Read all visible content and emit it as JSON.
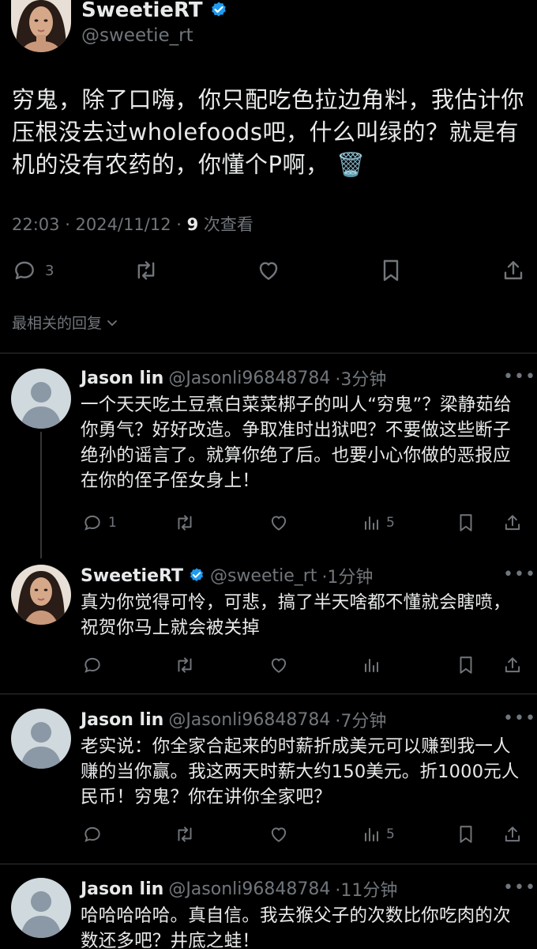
{
  "post": {
    "author_name": "SweetieRT",
    "author_handle": "@sweetie_rt",
    "text": "穷鬼，除了口嗨，你只配吃色拉边角料，我估计你压根没去过wholefoods吧，什么叫绿的？就是有机的没有农药的，你懂个P啊，",
    "emoji": "🗑️",
    "time": "22:03 · 2024/11/12 · ",
    "views_count": "9",
    "views_label": " 次查看",
    "reply_count": "3"
  },
  "sort_label": "最相关的回复",
  "replies": [
    {
      "name": "Jason lin",
      "handle": "@Jasonli96848784",
      "time": "·3分钟",
      "text": "一个天天吃土豆煮白菜菜梆子的叫人“穷鬼”？梁静茹给你勇气？好好改造。争取准时出狱吧？不要做这些断子绝孙的谣言了。就算你绝了后。也要小心你做的恶报应在你的侄子侄女身上！",
      "replies": "1",
      "views": "5"
    },
    {
      "name": "SweetieRT",
      "handle": "@sweetie_rt",
      "time": "·1分钟",
      "text": "真为你觉得可怜，可悲，搞了半天啥都不懂就会瞎喷，祝贺你马上就会被关掉",
      "replies": "",
      "views": ""
    },
    {
      "name": "Jason lin",
      "handle": "@Jasonli96848784",
      "time": "·7分钟",
      "text": "老实说：你全家合起来的时薪折成美元可以赚到我一人赚的当你赢。我这两天时薪大约150美元。折1000元人民币！穷鬼？你在讲你全家吧？",
      "replies": "",
      "views": "5"
    },
    {
      "name": "Jason lin",
      "handle": "@Jasonli96848784",
      "time": "·11分钟",
      "text": "哈哈哈哈哈。真自信。我去猴父子的次数比你吃肉的次数还多吧？井底之蛙！",
      "replies": "",
      "views": ""
    }
  ],
  "colors": {
    "verified": "#1d9bf0",
    "muted": "#71767b",
    "text": "#e7e9ea",
    "divider": "#2f3336"
  },
  "icons": [
    "verified-badge-icon",
    "reply-icon",
    "repost-icon",
    "like-icon",
    "bookmark-icon",
    "share-icon",
    "views-icon",
    "chevron-down-icon",
    "more-icon"
  ]
}
